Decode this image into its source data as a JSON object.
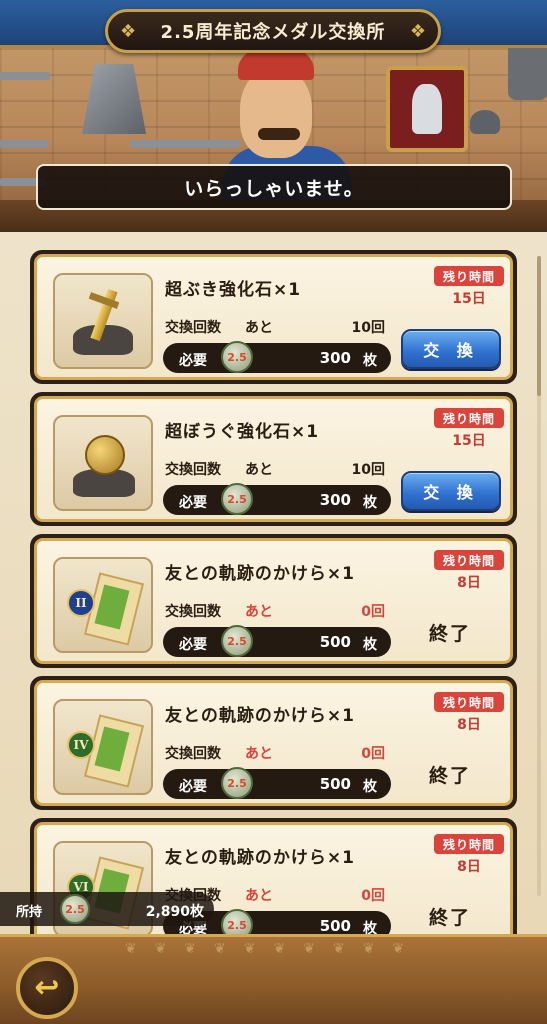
{
  "header": {
    "title": "2.5周年記念メダル交換所",
    "greeting": "いらっしゃいませ。"
  },
  "labels": {
    "remaining_time": "残り時間",
    "exchange_count": "交換回数",
    "remaining": "あと",
    "required": "必要",
    "unit": "枚",
    "exchange_button": "交 換",
    "finished": "終了",
    "medal_badge": "2.5"
  },
  "items": [
    {
      "name": "超ぶき強化石×1",
      "remaining_time": "15日",
      "count": "10回",
      "cost": "300",
      "status": "available",
      "icon": "sword-stone-icon"
    },
    {
      "name": "超ぼうぐ強化石×1",
      "remaining_time": "15日",
      "count": "10回",
      "cost": "300",
      "status": "available",
      "icon": "armor-orb-stone-icon"
    },
    {
      "name": "友との軌跡のかけら×1",
      "remaining_time": "8日",
      "count": "0回",
      "cost": "500",
      "status": "finished",
      "icon": "fragment-scroll-II-icon",
      "badge": "II"
    },
    {
      "name": "友との軌跡のかけら×1",
      "remaining_time": "8日",
      "count": "0回",
      "cost": "500",
      "status": "finished",
      "icon": "fragment-scroll-IV-icon",
      "badge": "IV"
    },
    {
      "name": "友との軌跡のかけら×1",
      "remaining_time": "8日",
      "count": "0回",
      "cost": "500",
      "status": "finished",
      "icon": "fragment-scroll-VI-icon",
      "badge": "VI"
    }
  ],
  "owned": {
    "label": "所持",
    "value": "2,890枚"
  },
  "colors": {
    "accent_blue": "#2f6fcf",
    "remaining_red": "#d9443b",
    "frame_gold": "#d5a94f"
  }
}
